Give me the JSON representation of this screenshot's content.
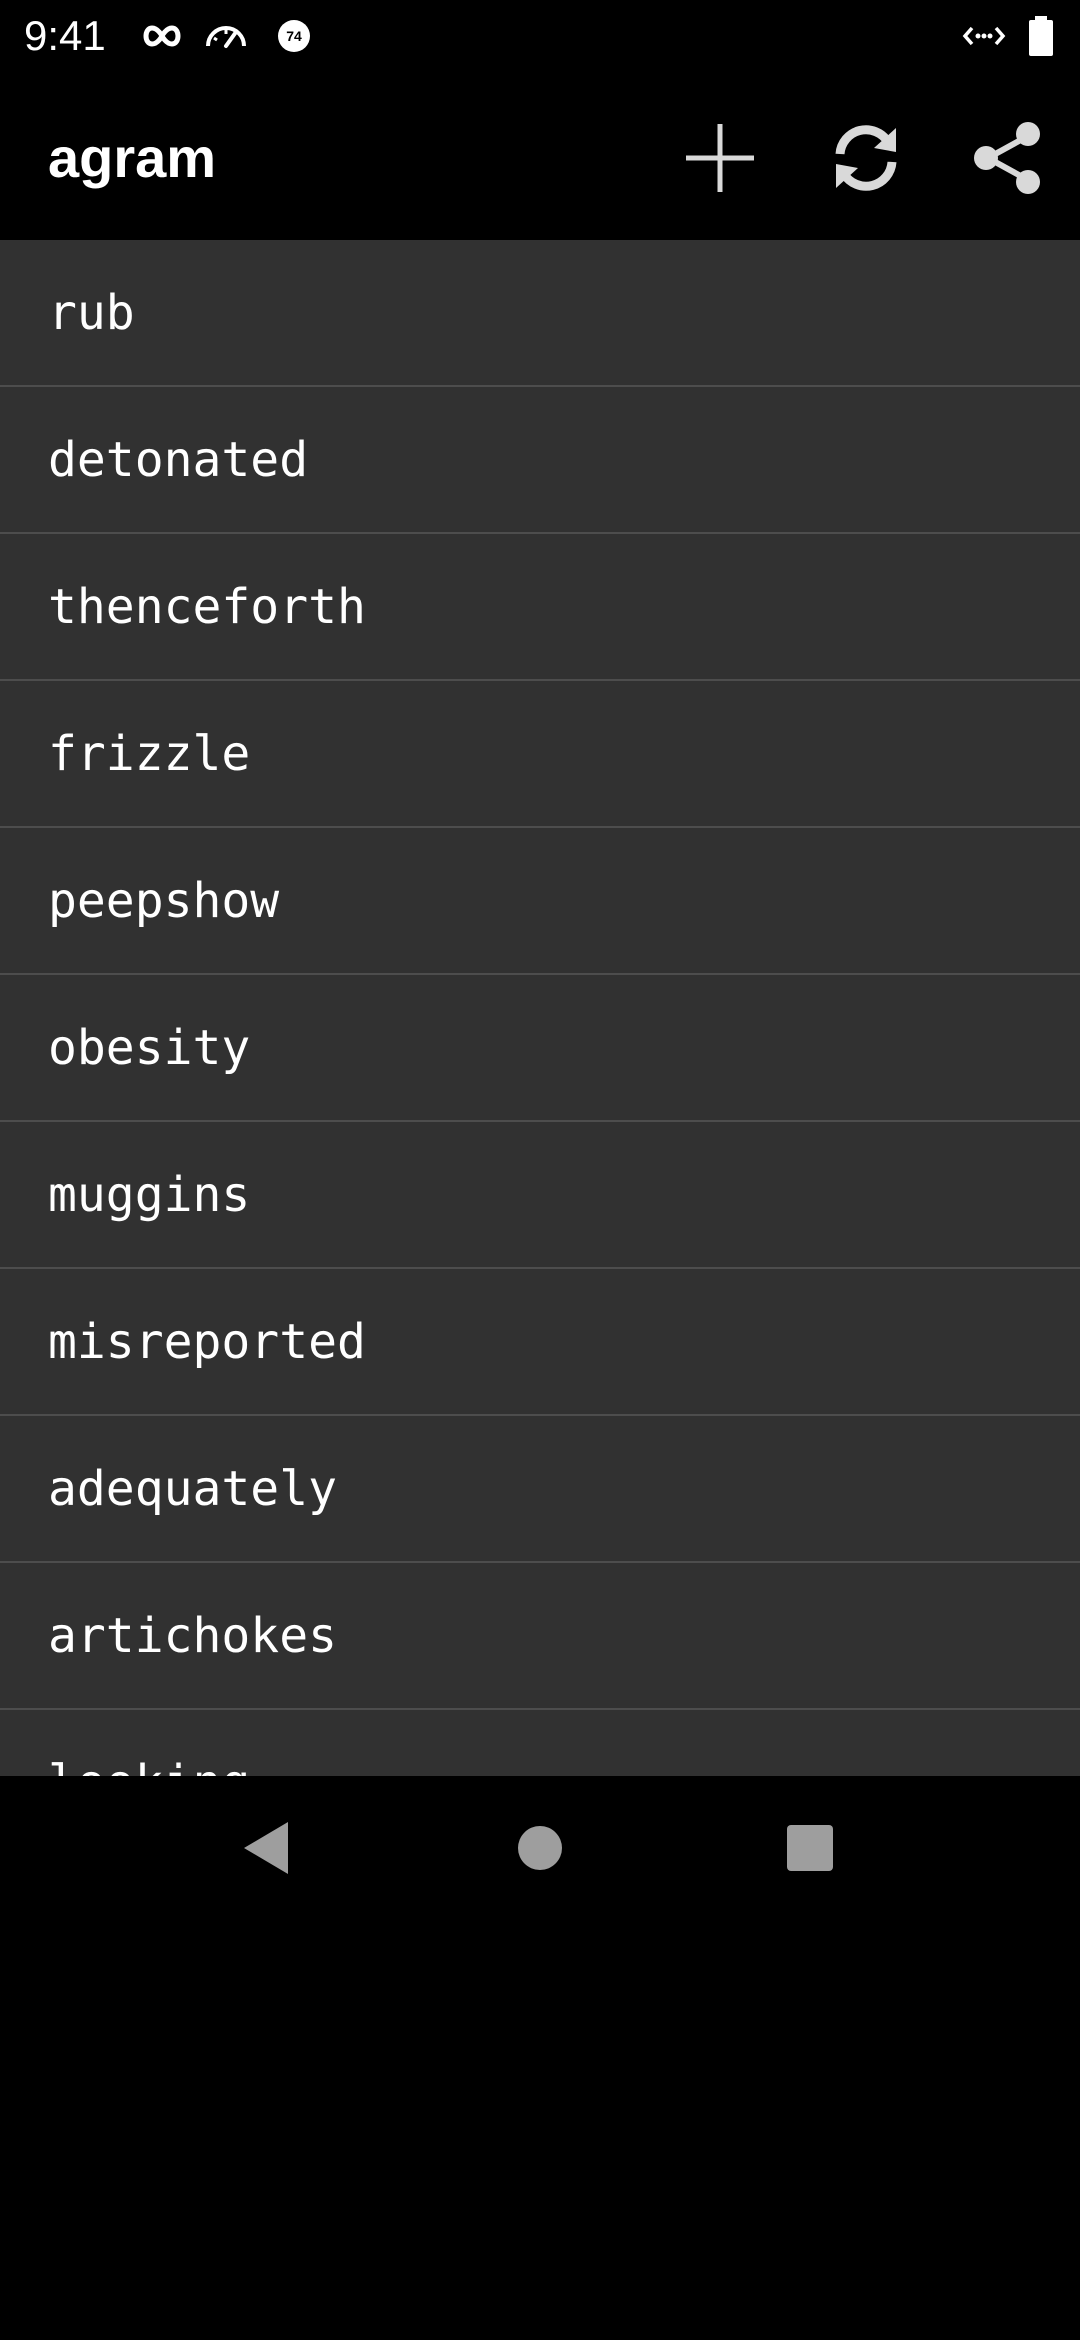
{
  "status_bar": {
    "time": "9:41",
    "icons_left": [
      "infinity-icon",
      "speedometer-icon",
      "notification-badge-icon"
    ],
    "badge_text": "74",
    "icons_right": [
      "code-arrows-icon",
      "battery-icon"
    ]
  },
  "app_bar": {
    "title": "agram",
    "actions": [
      {
        "name": "add",
        "icon": "plus-icon"
      },
      {
        "name": "refresh",
        "icon": "refresh-icon"
      },
      {
        "name": "share",
        "icon": "share-icon"
      }
    ]
  },
  "words": [
    "rub",
    "detonated",
    "thenceforth",
    "frizzle",
    "peepshow",
    "obesity",
    "muggins",
    "misreported",
    "adequately",
    "artichokes",
    "looking"
  ],
  "nav_bar": {
    "buttons": [
      "back-icon",
      "home-icon",
      "recents-icon"
    ]
  },
  "colors": {
    "background": "#000000",
    "list_background": "#313131",
    "divider": "#4d4d4d",
    "text": "#ffffff",
    "icon": "#d9d9d9",
    "nav_icon": "#9e9e9e"
  }
}
